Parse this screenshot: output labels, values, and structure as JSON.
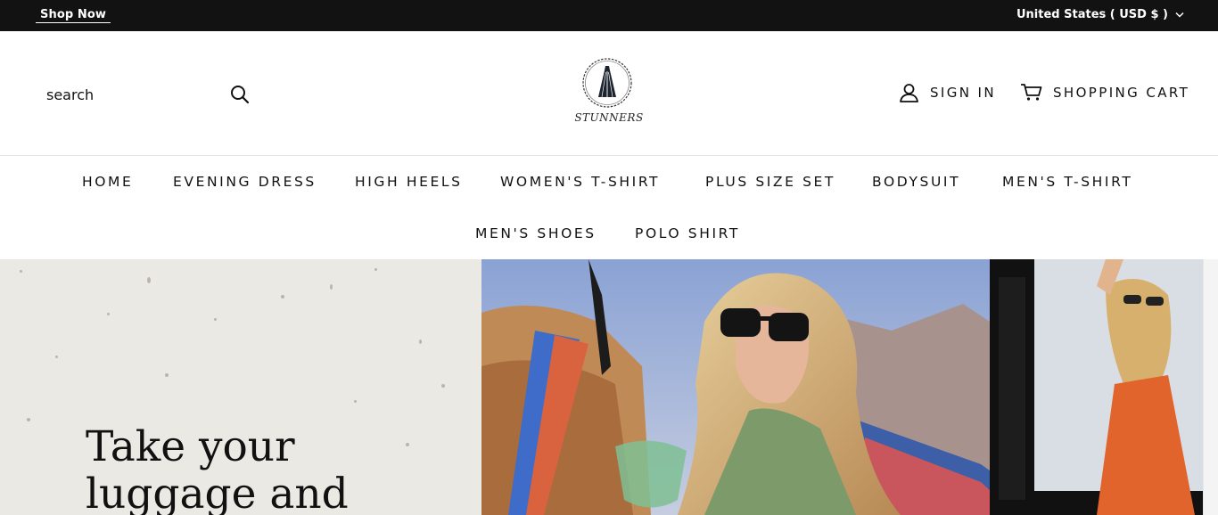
{
  "announcement": {
    "shop_now": "Shop Now",
    "currency": "United States ( USD $ )"
  },
  "header": {
    "search_placeholder": "search",
    "logo_text": "STUNNERS",
    "sign_in": "SIGN IN",
    "cart": "SHOPPING CART"
  },
  "nav": {
    "items": [
      "HOME",
      "EVENING DRESS",
      "HIGH HEELS",
      "WOMEN'S T-SHIRT",
      "PLUS SIZE SET",
      "BODYSUIT",
      "MEN'S T-SHIRT",
      "MEN'S SHOES",
      "POLO SHIRT"
    ]
  },
  "hero": {
    "title_line1": "Take your",
    "title_line2": "luggage and"
  },
  "colors": {
    "topbar_bg": "#121212",
    "hero_left_bg": "#ebe9e4"
  },
  "icons": [
    "chevron-down-icon",
    "search-icon",
    "user-icon",
    "cart-icon",
    "dress-logo-icon"
  ]
}
